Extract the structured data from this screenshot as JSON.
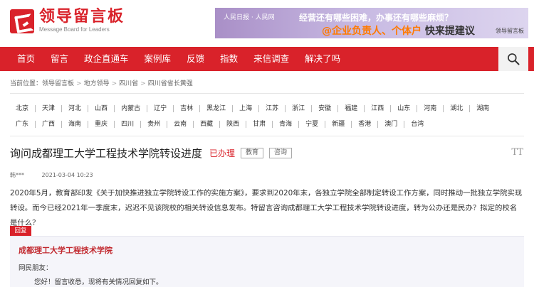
{
  "header": {
    "logo_title": "领导留言板",
    "logo_subtitle": "Message Board for Leaders",
    "banner": {
      "logos": "人民日报 · 人民网",
      "line1": "经营还有哪些困难，办事还有哪些麻烦？",
      "line2_orange": "@企业负责人、个体户",
      "line2_dark": "快来提建议",
      "qr_caption": "领导留言板"
    }
  },
  "nav": {
    "items": [
      "首页",
      "留言",
      "政企直通车",
      "案例库",
      "反馈",
      "指数",
      "来信调查",
      "解决了吗"
    ]
  },
  "breadcrumb": {
    "prefix": "当前位置：",
    "items": [
      "领导留言板",
      "地方领导",
      "四川省",
      "四川省省长黄强"
    ]
  },
  "regions": {
    "row1": [
      "北京",
      "天津",
      "河北",
      "山西",
      "内蒙古",
      "辽宁",
      "吉林",
      "黑龙江",
      "上海",
      "江苏",
      "浙江",
      "安徽",
      "福建",
      "江西",
      "山东",
      "河南",
      "湖北",
      "湖南"
    ],
    "row2": [
      "广东",
      "广西",
      "海南",
      "重庆",
      "四川",
      "贵州",
      "云南",
      "西藏",
      "陕西",
      "甘肃",
      "青海",
      "宁夏",
      "新疆",
      "香港",
      "澳门",
      "台湾"
    ]
  },
  "message": {
    "title": "询问成都理工大学工程技术学院转设进度",
    "status": "已办理",
    "tags": [
      "教育",
      "咨询"
    ],
    "font_icon": "TT",
    "author": "韩***",
    "date": "2021-03-04 10:23",
    "body": "2020年5月，教育部印发《关于加快推进独立学院转设工作的实施方案》，要求到2020年末，各独立学院全部制定转设工作方案，同时推动一批独立学院实现转设。而今已经2021年一季度末，迟迟不见该院校的相关转设信息发布。特留言咨询成都理工大学工程技术学院转设进度，转为公办还是民办？拟定的校名是什么？"
  },
  "reply": {
    "label": "回复",
    "org": "成都理工大学工程技术学院",
    "salutation": "网民朋友：",
    "text": "您好！留言收悉，现将有关情况回复如下。"
  },
  "colors": {
    "brand_red": "#d9222a",
    "reply_bg": "#f5f5fa"
  }
}
